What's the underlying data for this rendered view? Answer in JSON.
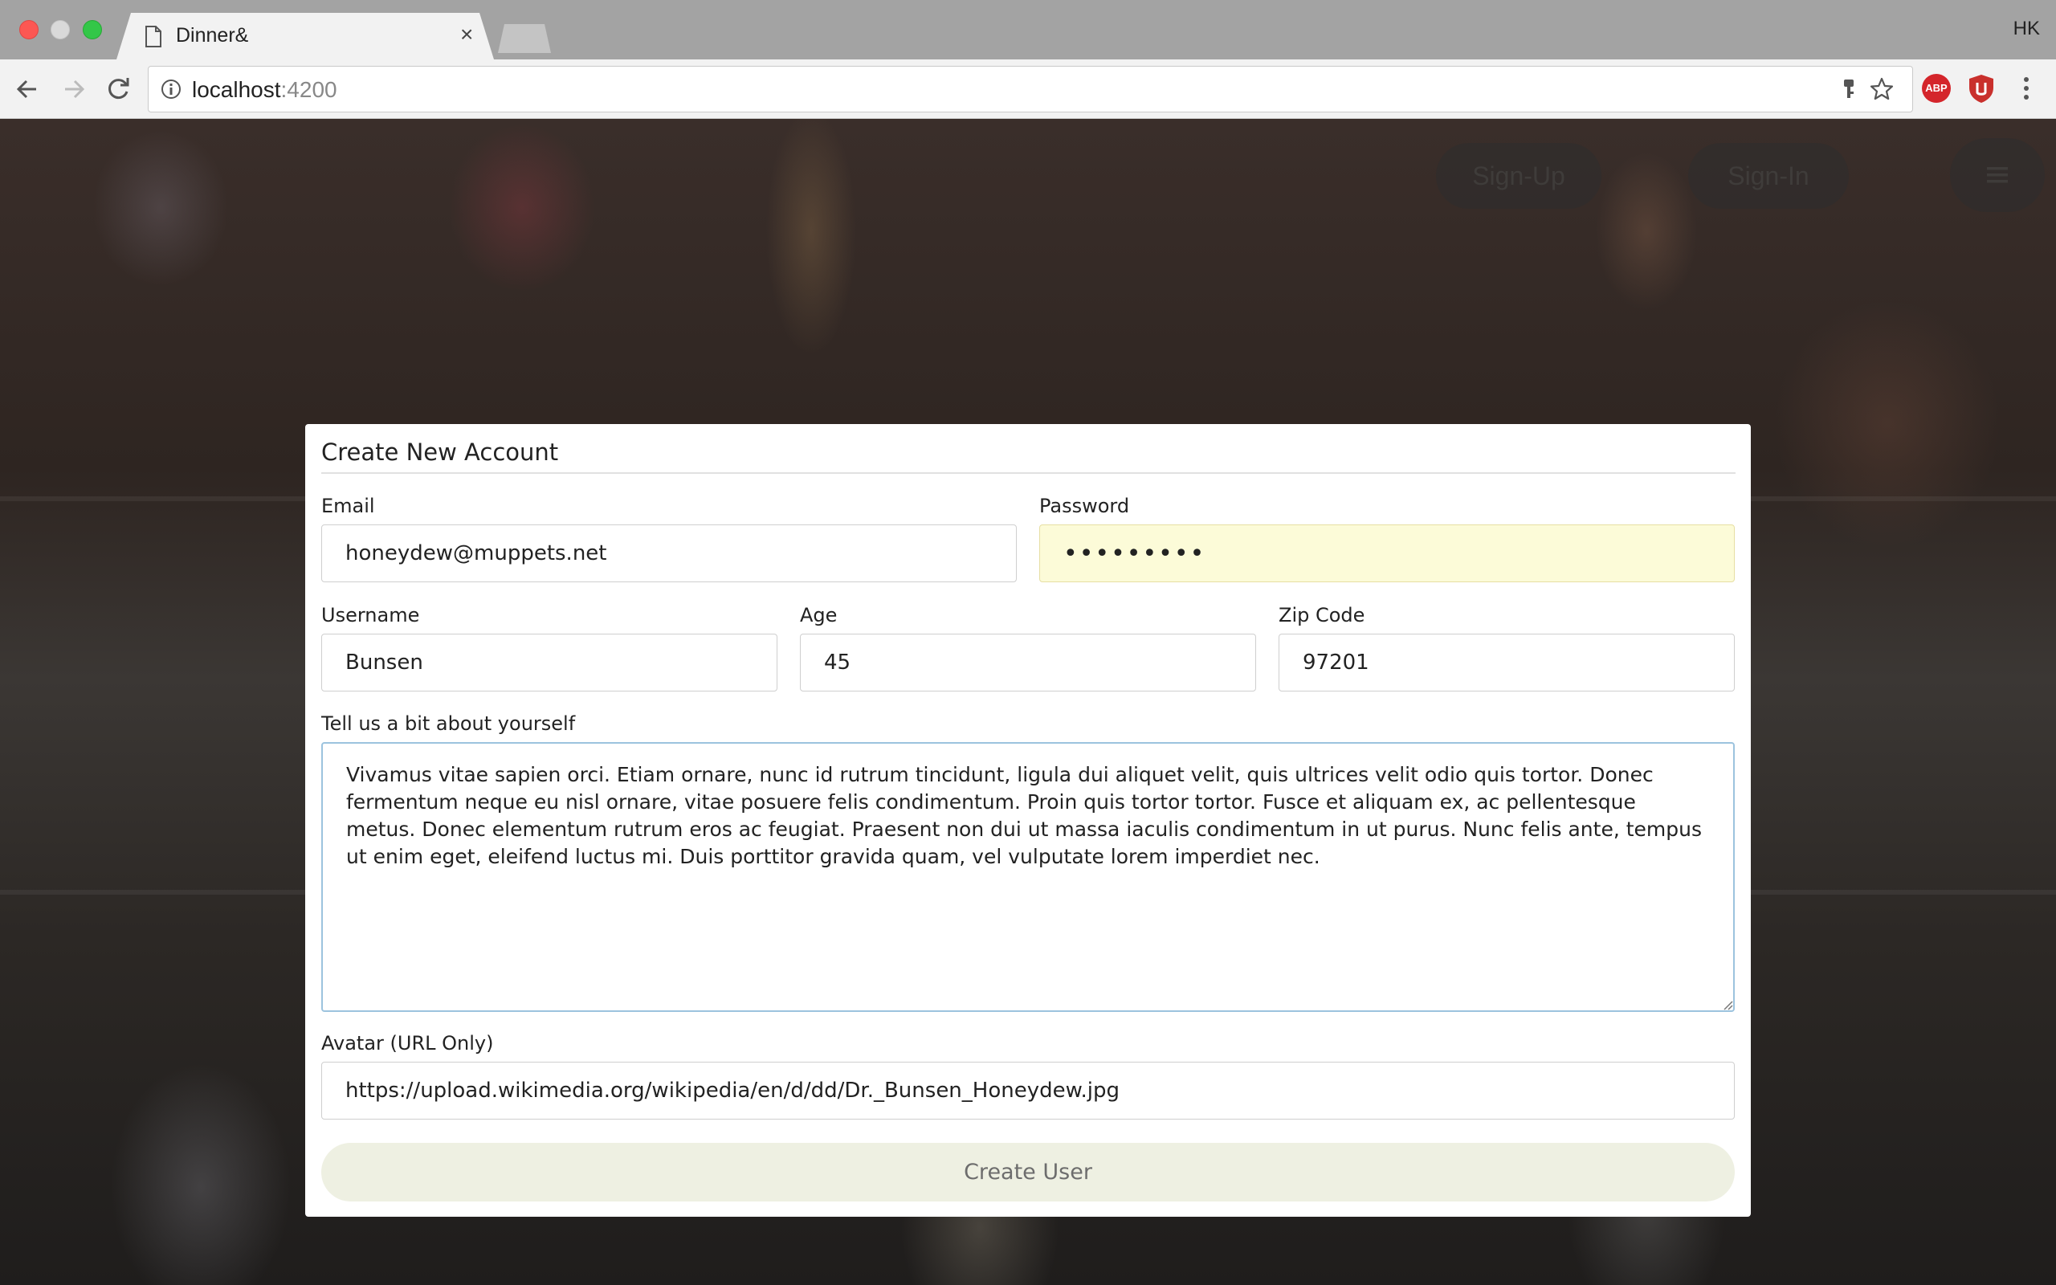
{
  "browser": {
    "tab_title": "Dinner&",
    "tab_close": "×",
    "profile_initials": "HK",
    "url_host": "localhost",
    "url_port": ":4200",
    "extensions": {
      "adblock_label": "ABP"
    }
  },
  "nav": {
    "signup_label": "Sign-Up",
    "signin_label": "Sign-In"
  },
  "form": {
    "title": "Create New Account",
    "email_label": "Email",
    "email_value": "honeydew@muppets.net",
    "password_label": "Password",
    "password_value": "•••••••••",
    "username_label": "Username",
    "username_value": "Bunsen",
    "age_label": "Age",
    "age_value": "45",
    "zip_label": "Zip Code",
    "zip_value": "97201",
    "about_label": "Tell us a bit about yourself",
    "about_value": "Vivamus vitae sapien orci. Etiam ornare, nunc id rutrum tincidunt, ligula dui aliquet velit, quis ultrices velit odio quis tortor. Donec fermentum neque eu nisl ornare, vitae posuere felis condimentum. Proin quis tortor tortor. Fusce et aliquam ex, ac pellentesque metus. Donec elementum rutrum eros ac feugiat. Praesent non dui ut massa iaculis condimentum in ut purus. Nunc felis ante, tempus ut enim eget, eleifend luctus mi. Duis porttitor gravida quam, vel vulputate lorem imperdiet nec.",
    "avatar_label": "Avatar (URL Only)",
    "avatar_value": "https://upload.wikimedia.org/wikipedia/en/d/dd/Dr._Bunsen_Honeydew.jpg",
    "submit_label": "Create User"
  },
  "colors": {
    "password_autofill_bg": "#fcfbd8",
    "textarea_focus_border": "#9cc3de",
    "submit_bg": "#eef0e2"
  }
}
